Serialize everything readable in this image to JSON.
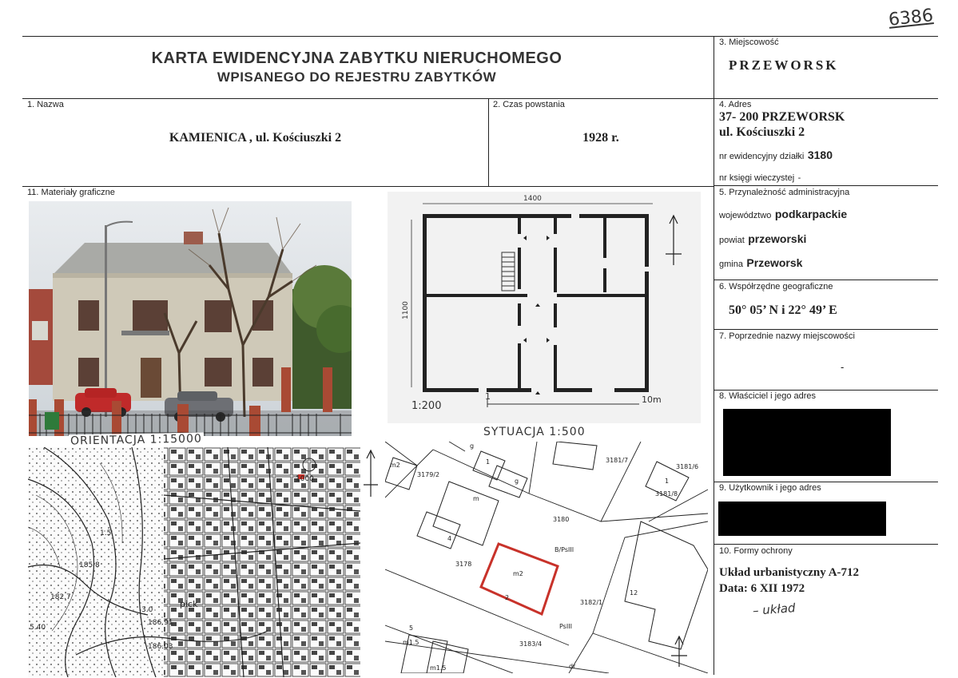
{
  "doc": {
    "corner_number": "6386",
    "title_line1": "KARTA EWIDENCYJNA ZABYTKU NIERUCHOMEGO",
    "title_line2": "WPISANEGO DO REJESTRU ZABYTKÓW"
  },
  "fields": {
    "miejscowosc": {
      "label": "3. Miejscowość",
      "value": "PRZEWORSK"
    },
    "nazwa": {
      "label": "1. Nazwa",
      "value": "KAMIENICA , ul. Kościuszki 2"
    },
    "czas": {
      "label": "2. Czas powstania",
      "value": "1928 r."
    },
    "adres": {
      "label": "4. Adres",
      "line1": "37- 200 PRZEWORSK",
      "line2": "ul. Kościuszki 2",
      "dzialka_label": "nr ewidencyjny działki",
      "dzialka_value": "3180",
      "ksiega_label": "nr księgi wieczystej",
      "ksiega_value": "-"
    },
    "materialy": {
      "label": "11. Materiały graficzne"
    },
    "przynaleznosc": {
      "label": "5. Przynależność administracyjna",
      "woj_label": "województwo",
      "woj_value": "podkarpackie",
      "powiat_label": "powiat",
      "powiat_value": "przeworski",
      "gmina_label": "gmina",
      "gmina_value": "Przeworsk"
    },
    "wspolrzedne": {
      "label": "6. Współrzędne geograficzne",
      "value": "50° 05’ N i 22° 49’ E"
    },
    "poprzednie": {
      "label": "7. Poprzednie nazwy miejscowości",
      "value": "-"
    },
    "wlasciciel": {
      "label": "8. Właściciel i jego adres"
    },
    "uzytkownik": {
      "label": "9. Użytkownik i jego adres"
    },
    "formy": {
      "label": "10. Formy ochrony",
      "line1": "Układ urbanistyczny A-712",
      "line2": "Data: 6 XII 1972",
      "handwritten": "– układ"
    }
  },
  "plan": {
    "top_dim": "1400",
    "side_dim": "1100",
    "scale": "1:200",
    "bar_start": "1",
    "bar_end": "10m"
  },
  "orientacja": {
    "title": "ORIENTACJA  1:15000",
    "labels": [
      "1000",
      "185.8",
      "182.7",
      "5.40",
      "186.91",
      "pick",
      "186.03",
      "1.5",
      "3.0"
    ]
  },
  "sytuacja": {
    "title": "SYTUACJA  1:500",
    "parcels": [
      "m2",
      "3179/2",
      "g",
      "1",
      "g",
      "3181/7",
      "3181/6",
      "1",
      "3181/8",
      "m",
      "4",
      "3180",
      "B/PsIII",
      "3178",
      "m2",
      "2",
      "3182/1",
      "12",
      "PsIII",
      "5",
      "m1.5",
      "m1.5",
      "3183/4",
      "dr"
    ]
  }
}
